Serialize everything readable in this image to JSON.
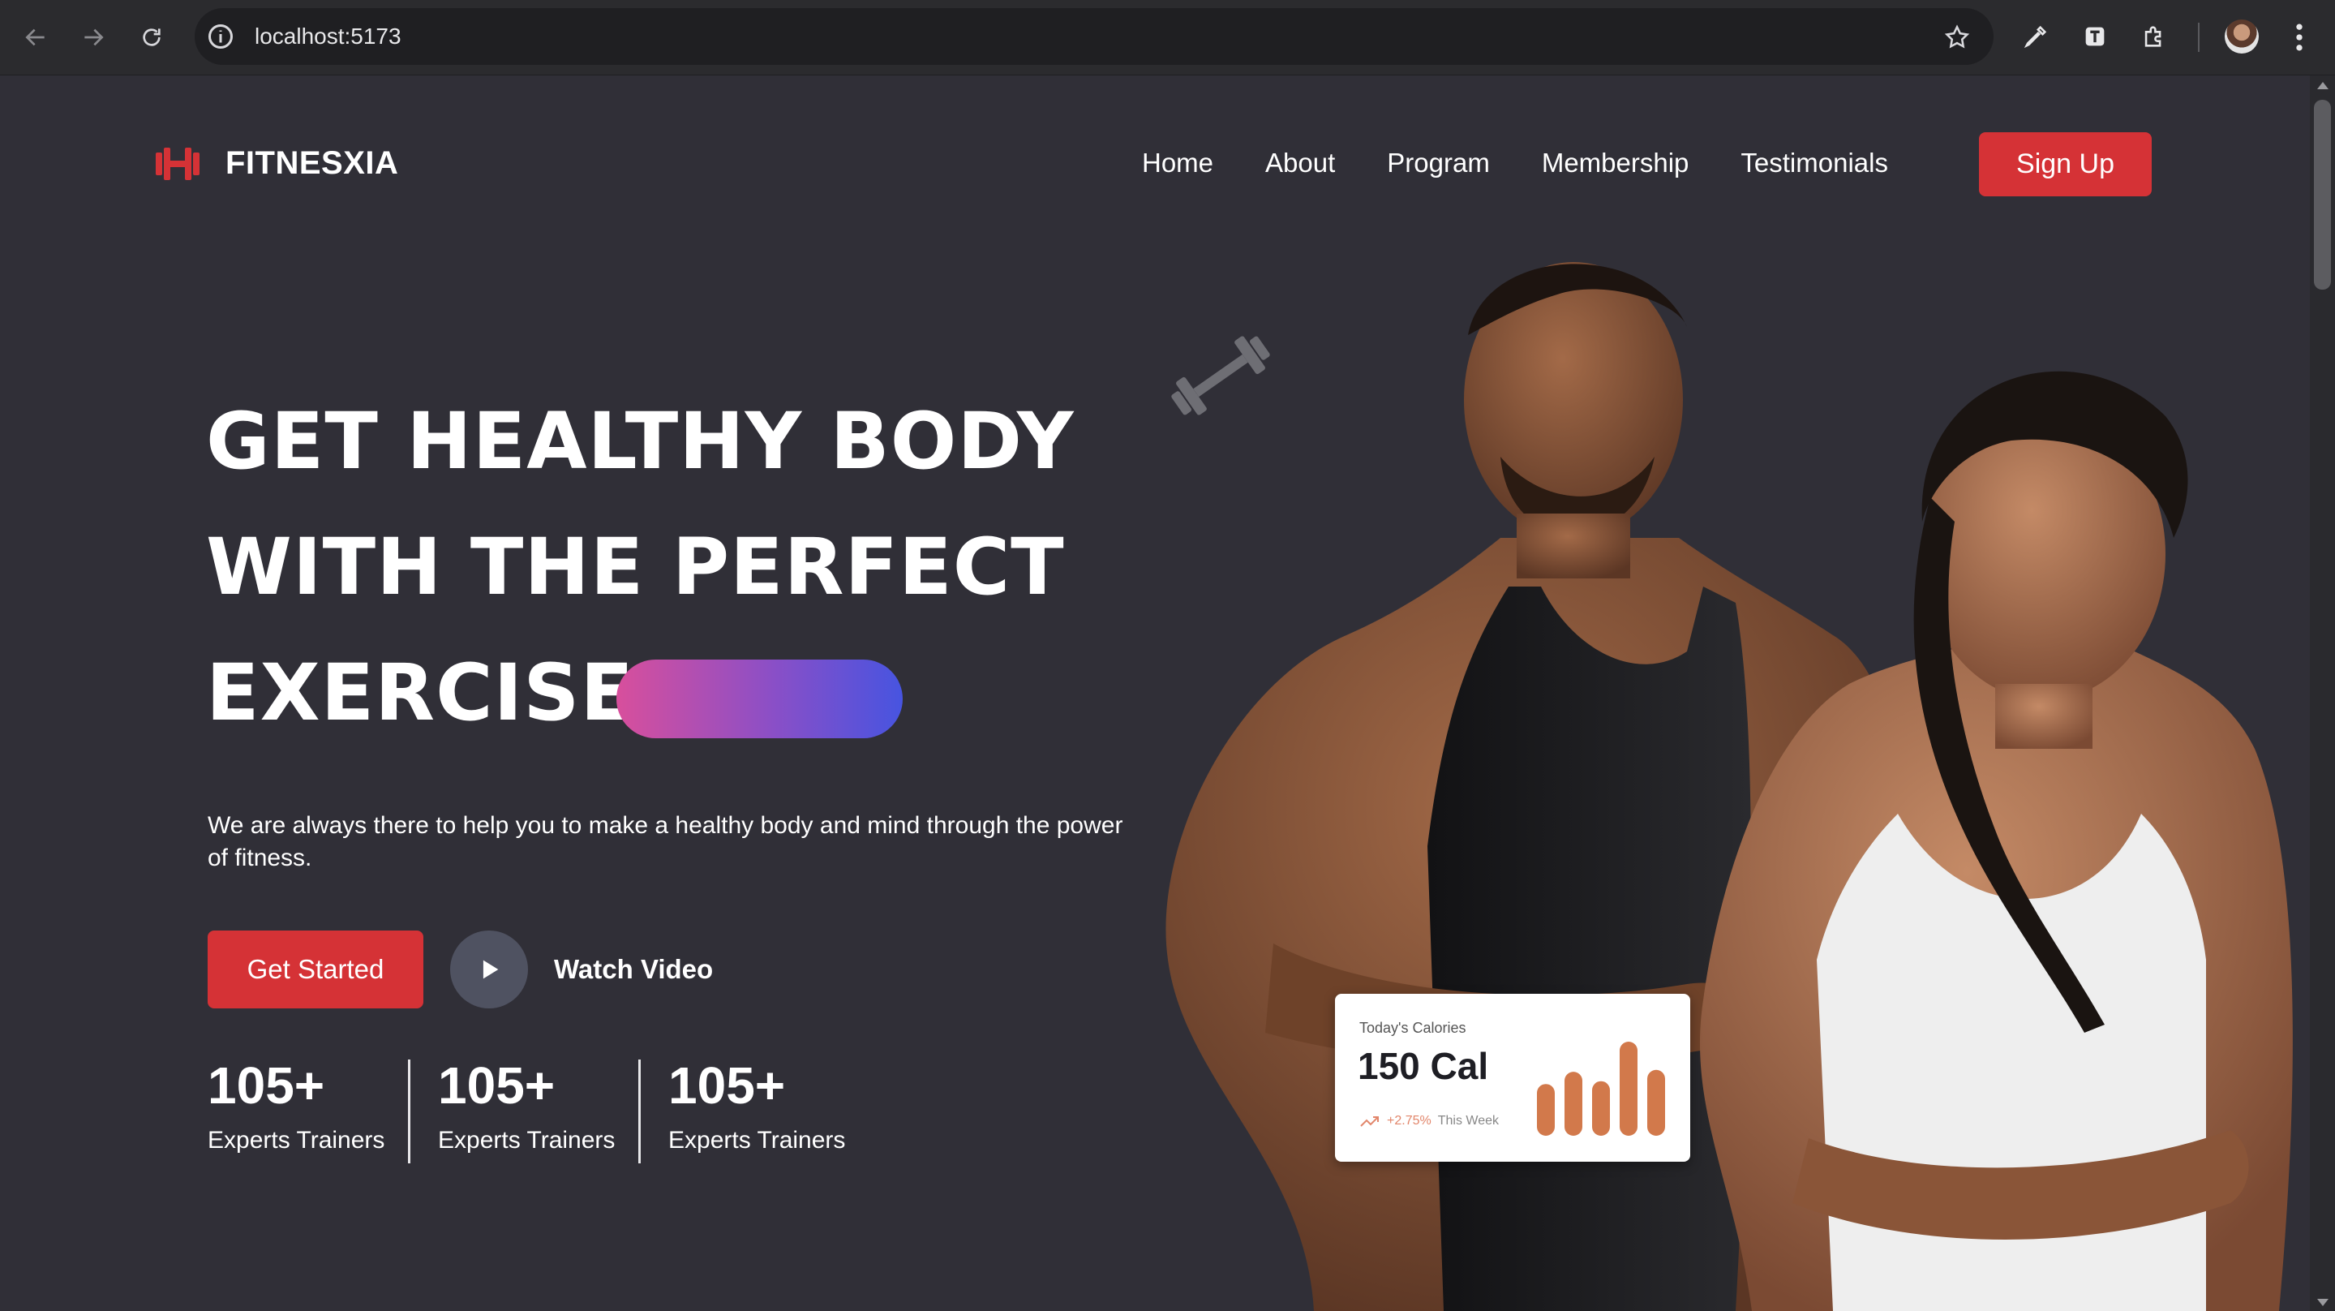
{
  "browser": {
    "url": "localhost:5173"
  },
  "site": {
    "brand": "FITNESXIA",
    "nav": [
      "Home",
      "About",
      "Program",
      "Membership",
      "Testimonials"
    ],
    "signup_label": "Sign Up"
  },
  "hero": {
    "line1": "GET HEALTHY BODY",
    "line2": "WITH THE PERFECT",
    "line3": "EXERCISE",
    "description": "We are always there to help you to make a healthy body and mind through the power of fitness.",
    "get_started_label": "Get Started",
    "watch_video_label": "Watch Video",
    "stats": [
      {
        "value": "105+",
        "label": "Experts Trainers"
      },
      {
        "value": "105+",
        "label": "Experts Trainers"
      },
      {
        "value": "105+",
        "label": "Experts Trainers"
      }
    ],
    "pill_gradient": [
      "#d84f9c",
      "#8a4fc7",
      "#4754e0"
    ]
  },
  "calorie_card": {
    "title": "Today's Calories",
    "value": "150 Cal",
    "change": "+2.75%",
    "period": "This Week",
    "bar_levels": [
      0.55,
      0.68,
      0.58,
      1.0,
      0.7
    ]
  },
  "colors": {
    "accent": "#d53236",
    "page_bg": "#302f37",
    "bar_color": "#d2794b"
  }
}
